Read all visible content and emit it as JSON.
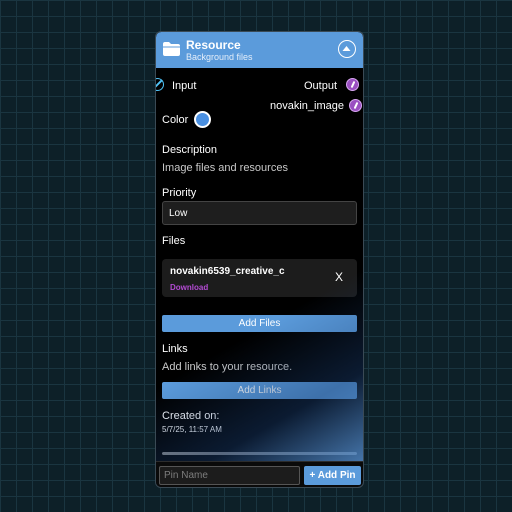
{
  "node": {
    "title": "Resource",
    "subtitle": "Background files",
    "accent_color": "#5b9bdb",
    "folder_icon": "folder-icon",
    "collapse_icon": "chevron-up-icon"
  },
  "pins": {
    "input_label": "Input",
    "output_label": "Output",
    "extra_output_label": "novakin_image"
  },
  "color": {
    "label": "Color",
    "value": "#4a90e2"
  },
  "description": {
    "label": "Description",
    "text": "Image files and resources"
  },
  "priority": {
    "label": "Priority",
    "value": "Low"
  },
  "files": {
    "label": "Files",
    "items": [
      {
        "name": "novakin6539_creative_c",
        "download_label": "Download",
        "remove_label": "X"
      }
    ],
    "add_button": "Add Files"
  },
  "links": {
    "label": "Links",
    "placeholder_text": "Add links to your resource.",
    "add_button": "Add Links"
  },
  "created": {
    "label": "Created on:",
    "value": "5/7/25, 11:57 AM"
  },
  "progress": {
    "fraction": 1.0
  },
  "footer": {
    "pin_name_placeholder": "Pin Name",
    "add_pin_button": "+ Add Pin"
  }
}
